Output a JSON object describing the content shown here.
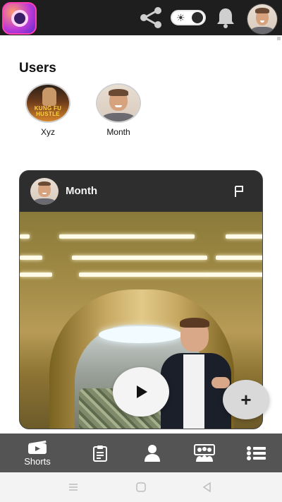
{
  "topbar": {
    "icons": [
      "app-logo-icon",
      "share-icon",
      "theme-toggle",
      "bell-icon",
      "avatar"
    ]
  },
  "users": {
    "title": "Users",
    "items": [
      {
        "label": "Xyz",
        "poster_text": "KUNG FU HUSTLE"
      },
      {
        "label": "Month"
      }
    ]
  },
  "card": {
    "username": "Month",
    "icons": [
      "flag-icon",
      "play-icon"
    ]
  },
  "fab": {
    "label": "+"
  },
  "bottom_nav": {
    "items": [
      {
        "label": "Shorts",
        "icon": "shorts-icon"
      },
      {
        "icon": "clipboard-icon"
      },
      {
        "icon": "person-icon"
      },
      {
        "icon": "group-icon"
      },
      {
        "icon": "list-icon"
      }
    ]
  },
  "system_bar": {
    "icons": [
      "menu-icon",
      "home-icon",
      "back-icon"
    ]
  },
  "colors": {
    "topbar_bg": "#1e1e1e",
    "card_bg": "#2e2e2e",
    "bottom_nav_bg": "#545454",
    "accent_logo": "#ff3fb2"
  }
}
